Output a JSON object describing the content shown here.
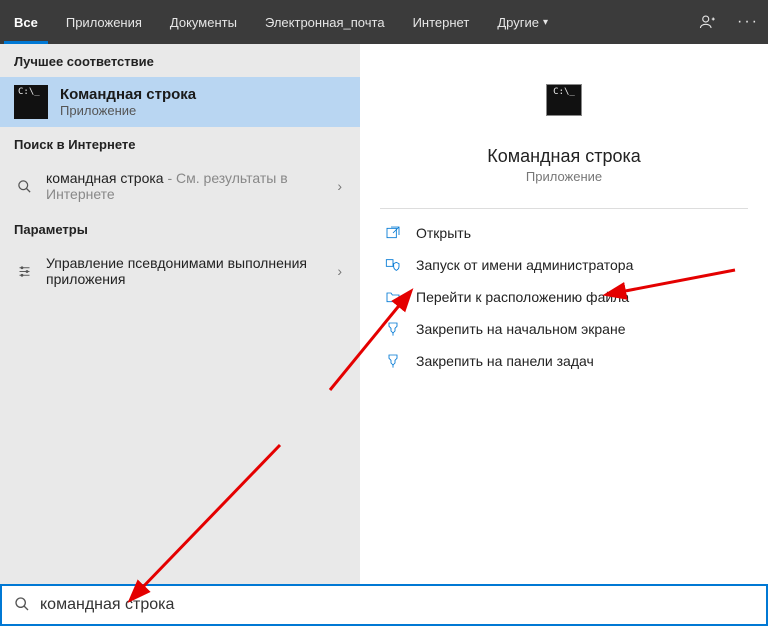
{
  "tabs": {
    "items": [
      {
        "label": "Все",
        "active": true
      },
      {
        "label": "Приложения"
      },
      {
        "label": "Документы"
      },
      {
        "label": "Электронная_почта"
      },
      {
        "label": "Интернет"
      },
      {
        "label": "Другие",
        "dropdown": true
      }
    ]
  },
  "left": {
    "best_header": "Лучшее соответствие",
    "best_title": "Командная строка",
    "best_sub": "Приложение",
    "web_header": "Поиск в Интернете",
    "web_query": "командная строка",
    "web_suffix": " - См. результаты в Интернете",
    "settings_header": "Параметры",
    "settings_item": "Управление псевдонимами выполнения приложения"
  },
  "preview": {
    "title": "Командная строка",
    "sub": "Приложение",
    "actions": [
      {
        "id": "open",
        "label": "Открыть"
      },
      {
        "id": "run-admin",
        "label": "Запуск от имени администратора"
      },
      {
        "id": "open-loc",
        "label": "Перейти к расположению файла"
      },
      {
        "id": "pin-start",
        "label": "Закрепить на начальном экране"
      },
      {
        "id": "pin-taskbar",
        "label": "Закрепить на панели задач"
      }
    ]
  },
  "search": {
    "value": "командная строка"
  },
  "cmd_prompt_glyph": "C:\\_"
}
